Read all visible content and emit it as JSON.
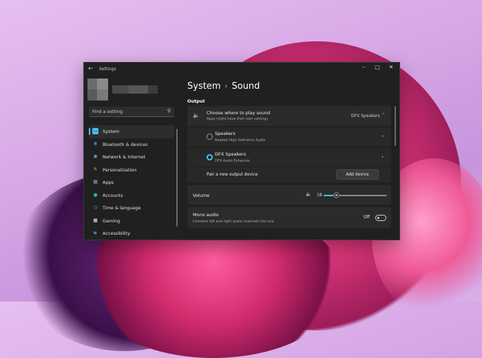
{
  "window": {
    "app_title": "Settings",
    "heading_parent": "System",
    "heading_child": "Sound",
    "section_title": "Output"
  },
  "search": {
    "placeholder": "Find a setting"
  },
  "nav": [
    {
      "label": "System",
      "icon": "system-icon",
      "color": "#4cc2ff",
      "active": true
    },
    {
      "label": "Bluetooth & devices",
      "icon": "bluetooth-icon",
      "color": "#2b8fe0"
    },
    {
      "label": "Network & internet",
      "icon": "wifi-icon",
      "color": "#5aa6e8"
    },
    {
      "label": "Personalization",
      "icon": "brush-icon",
      "color": "#e9a44a"
    },
    {
      "label": "Apps",
      "icon": "apps-icon",
      "color": "#7aa7d9"
    },
    {
      "label": "Accounts",
      "icon": "person-icon",
      "color": "#34b58a"
    },
    {
      "label": "Time & language",
      "icon": "globe-clock-icon",
      "color": "#3e9be6"
    },
    {
      "label": "Gaming",
      "icon": "gamepad-icon",
      "color": "#a9a9a9"
    },
    {
      "label": "Accessibility",
      "icon": "accessibility-icon",
      "color": "#4aa3ef"
    }
  ],
  "output": {
    "title": "Choose where to play sound",
    "subtitle": "Apps might have their own settings",
    "selected_device": "DFX Speakers",
    "devices": [
      {
        "name": "Speakers",
        "desc": "Realtek High Definition Audio",
        "selected": false
      },
      {
        "name": "DFX Speakers",
        "desc": "DFX Audio Enhancer",
        "selected": true
      }
    ],
    "pair_label": "Pair a new output device",
    "add_button": "Add device"
  },
  "volume": {
    "label": "Volume",
    "value": "18",
    "level": 0.18
  },
  "mono": {
    "title": "Mono audio",
    "subtitle": "Combine left and right audio channels into one",
    "state": "Off"
  }
}
